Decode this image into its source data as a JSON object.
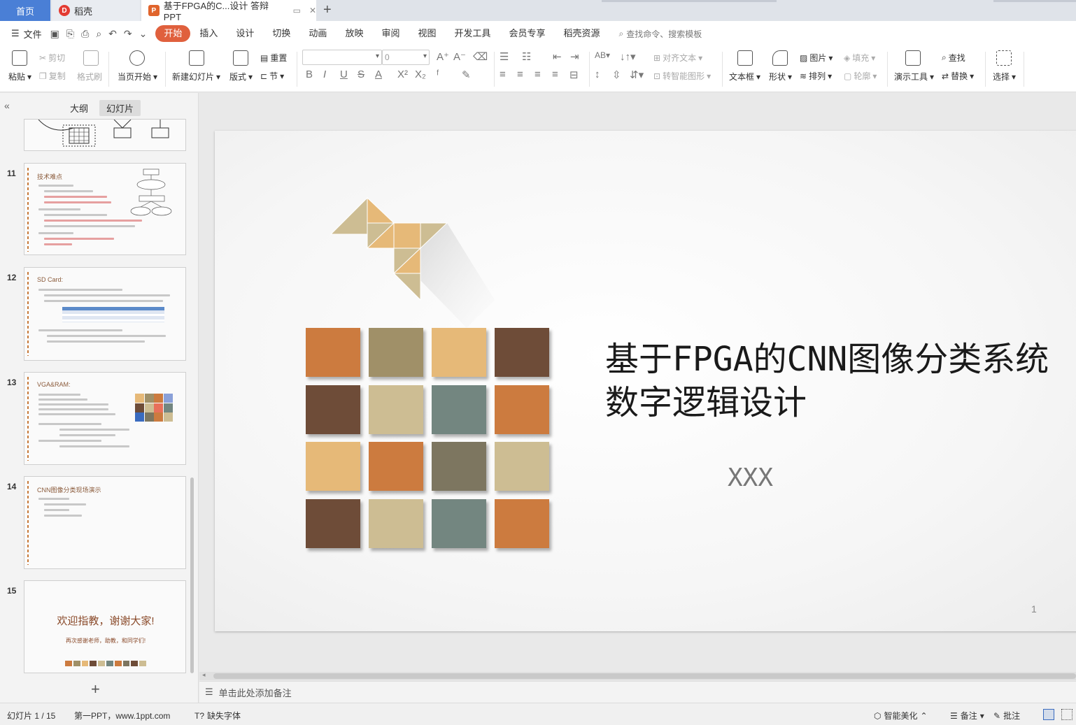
{
  "tabs": {
    "home": "首页",
    "daoke": "稻壳",
    "doc": "基于FPGA的C...设计 答辩PPT",
    "doc_badge": "P",
    "daoke_badge": "D"
  },
  "menu": {
    "file": "文件",
    "items": [
      "开始",
      "插入",
      "设计",
      "切换",
      "动画",
      "放映",
      "审阅",
      "视图",
      "开发工具",
      "会员专享",
      "稻壳资源"
    ],
    "search": "查找命令、搜索模板"
  },
  "ribbon": {
    "paste": "粘贴",
    "cut": "剪切",
    "copy": "复制",
    "format_painter": "格式刷",
    "play_from_current": "当页开始",
    "new_slide": "新建幻灯片",
    "layout": "版式",
    "section": "节",
    "reset": "重置",
    "font_size": "0",
    "align_text": "对齐文本",
    "smart_art": "转智能图形",
    "textbox": "文本框",
    "shapes": "形状",
    "picture": "图片",
    "arrange": "排列",
    "fill": "填充",
    "outline": "轮廓",
    "presenter_tools": "演示工具",
    "find": "查找",
    "replace": "替换",
    "select": "选择"
  },
  "panel": {
    "outline_tab": "大纲",
    "slides_tab": "幻灯片",
    "thumbs": [
      {
        "num": "11",
        "title": "技术难点"
      },
      {
        "num": "12",
        "title": "SD Card:"
      },
      {
        "num": "13",
        "title": "VGA&RAM:"
      },
      {
        "num": "14",
        "title": "CNN图像分类现场演示"
      },
      {
        "num": "15",
        "title": "欢迎指教，谢谢大家!",
        "subtitle": "再次感谢老师，助教，和同学们!"
      }
    ]
  },
  "slide": {
    "title_line1": "基于FPGA的CNN图像分类系统",
    "title_line2": "数字逻辑设计",
    "author": "XXX",
    "page_number": "1",
    "palette": {
      "orange": "#cc7b3f",
      "olive": "#a09068",
      "sand": "#e6b978",
      "brown": "#6e4c38",
      "beige": "#cdbd93",
      "slate": "#738680",
      "taupe": "#7d7660"
    }
  },
  "notes": {
    "placeholder": "单击此处添加备注"
  },
  "status": {
    "slide_counter": "幻灯片 1 / 15",
    "theme": "第一PPT，www.1ppt.com",
    "missing_fonts": "缺失字体",
    "beautify": "智能美化",
    "notes": "备注",
    "comments": "批注"
  }
}
